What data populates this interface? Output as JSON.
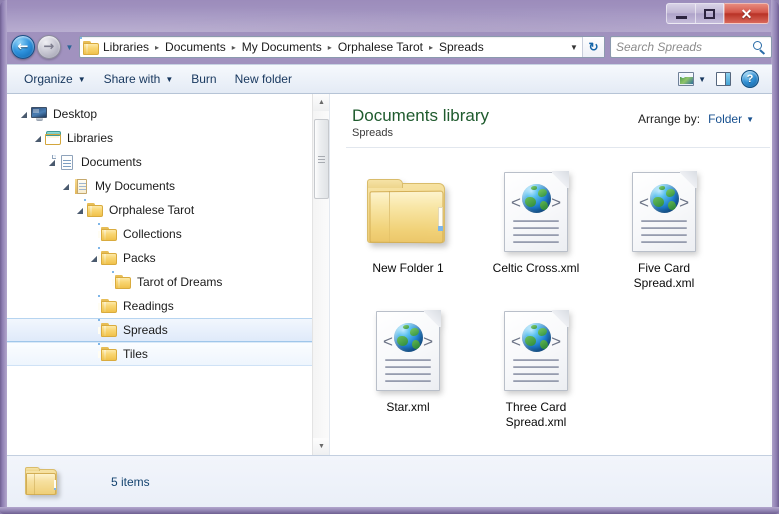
{
  "window": {
    "caption": {
      "minimize": "Minimize",
      "maximize": "Maximize",
      "close": "✕"
    }
  },
  "address_bar": {
    "back_label": "←",
    "forward_label": "→",
    "history_caret": "▼",
    "breadcrumbs": [
      "Libraries",
      "Documents",
      "My Documents",
      "Orphalese Tarot",
      "Spreads"
    ],
    "separator": "▸",
    "dropdown_caret": "▼",
    "refresh_label": "↻"
  },
  "search": {
    "placeholder": "Search Spreads",
    "value": ""
  },
  "toolbar": {
    "organize_label": "Organize",
    "share_label": "Share with",
    "burn_label": "Burn",
    "new_folder_label": "New folder",
    "caret": "▼",
    "view_icon": "view-icon",
    "preview_pane_icon": "preview-pane-icon",
    "help_label": "?"
  },
  "nav_tree": {
    "items": [
      {
        "label": "Desktop",
        "indent": 0,
        "icon": "desktop-icon",
        "expander": "open",
        "state": "normal"
      },
      {
        "label": "Libraries",
        "indent": 1,
        "icon": "libraries-icon",
        "expander": "open",
        "state": "normal"
      },
      {
        "label": "Documents",
        "indent": 2,
        "icon": "documents-icon",
        "expander": "open",
        "state": "normal"
      },
      {
        "label": "My Documents",
        "indent": 3,
        "icon": "my-documents-icon",
        "expander": "open",
        "state": "normal"
      },
      {
        "label": "Orphalese Tarot",
        "indent": 4,
        "icon": "folder-icon",
        "expander": "open",
        "state": "normal"
      },
      {
        "label": "Collections",
        "indent": 5,
        "icon": "folder-icon",
        "expander": "none",
        "state": "normal"
      },
      {
        "label": "Packs",
        "indent": 5,
        "icon": "folder-icon",
        "expander": "open",
        "state": "normal"
      },
      {
        "label": "Tarot of Dreams",
        "indent": 6,
        "icon": "folder-icon",
        "expander": "none",
        "state": "normal"
      },
      {
        "label": "Readings",
        "indent": 5,
        "icon": "folder-icon",
        "expander": "none",
        "state": "normal"
      },
      {
        "label": "Spreads",
        "indent": 5,
        "icon": "folder-icon",
        "expander": "none",
        "state": "selected"
      },
      {
        "label": "Tiles",
        "indent": 5,
        "icon": "folder-icon",
        "expander": "none",
        "state": "hover"
      }
    ],
    "expander_open_glyph": "◢",
    "expander_closed_glyph": "▸"
  },
  "content": {
    "library_title": "Documents library",
    "library_subtitle": "Spreads",
    "arrange_label": "Arrange by:",
    "arrange_value": "Folder",
    "arrange_caret": "▼",
    "items": [
      {
        "name": "New Folder 1",
        "type": "folder"
      },
      {
        "name": "Celtic Cross.xml",
        "type": "xml"
      },
      {
        "name": "Five Card\nSpread.xml",
        "type": "xml"
      },
      {
        "name": "Star.xml",
        "type": "xml"
      },
      {
        "name": "Three Card\nSpread.xml",
        "type": "xml"
      }
    ]
  },
  "status_bar": {
    "item_count_text": "5 items",
    "icon": "folder-icon"
  },
  "colors": {
    "frame": "#a294c1",
    "library_title": "#1f5b2e",
    "link": "#17508f",
    "status_text": "#14436f",
    "selection": "#dfeafa",
    "close_button": "#b93226"
  }
}
